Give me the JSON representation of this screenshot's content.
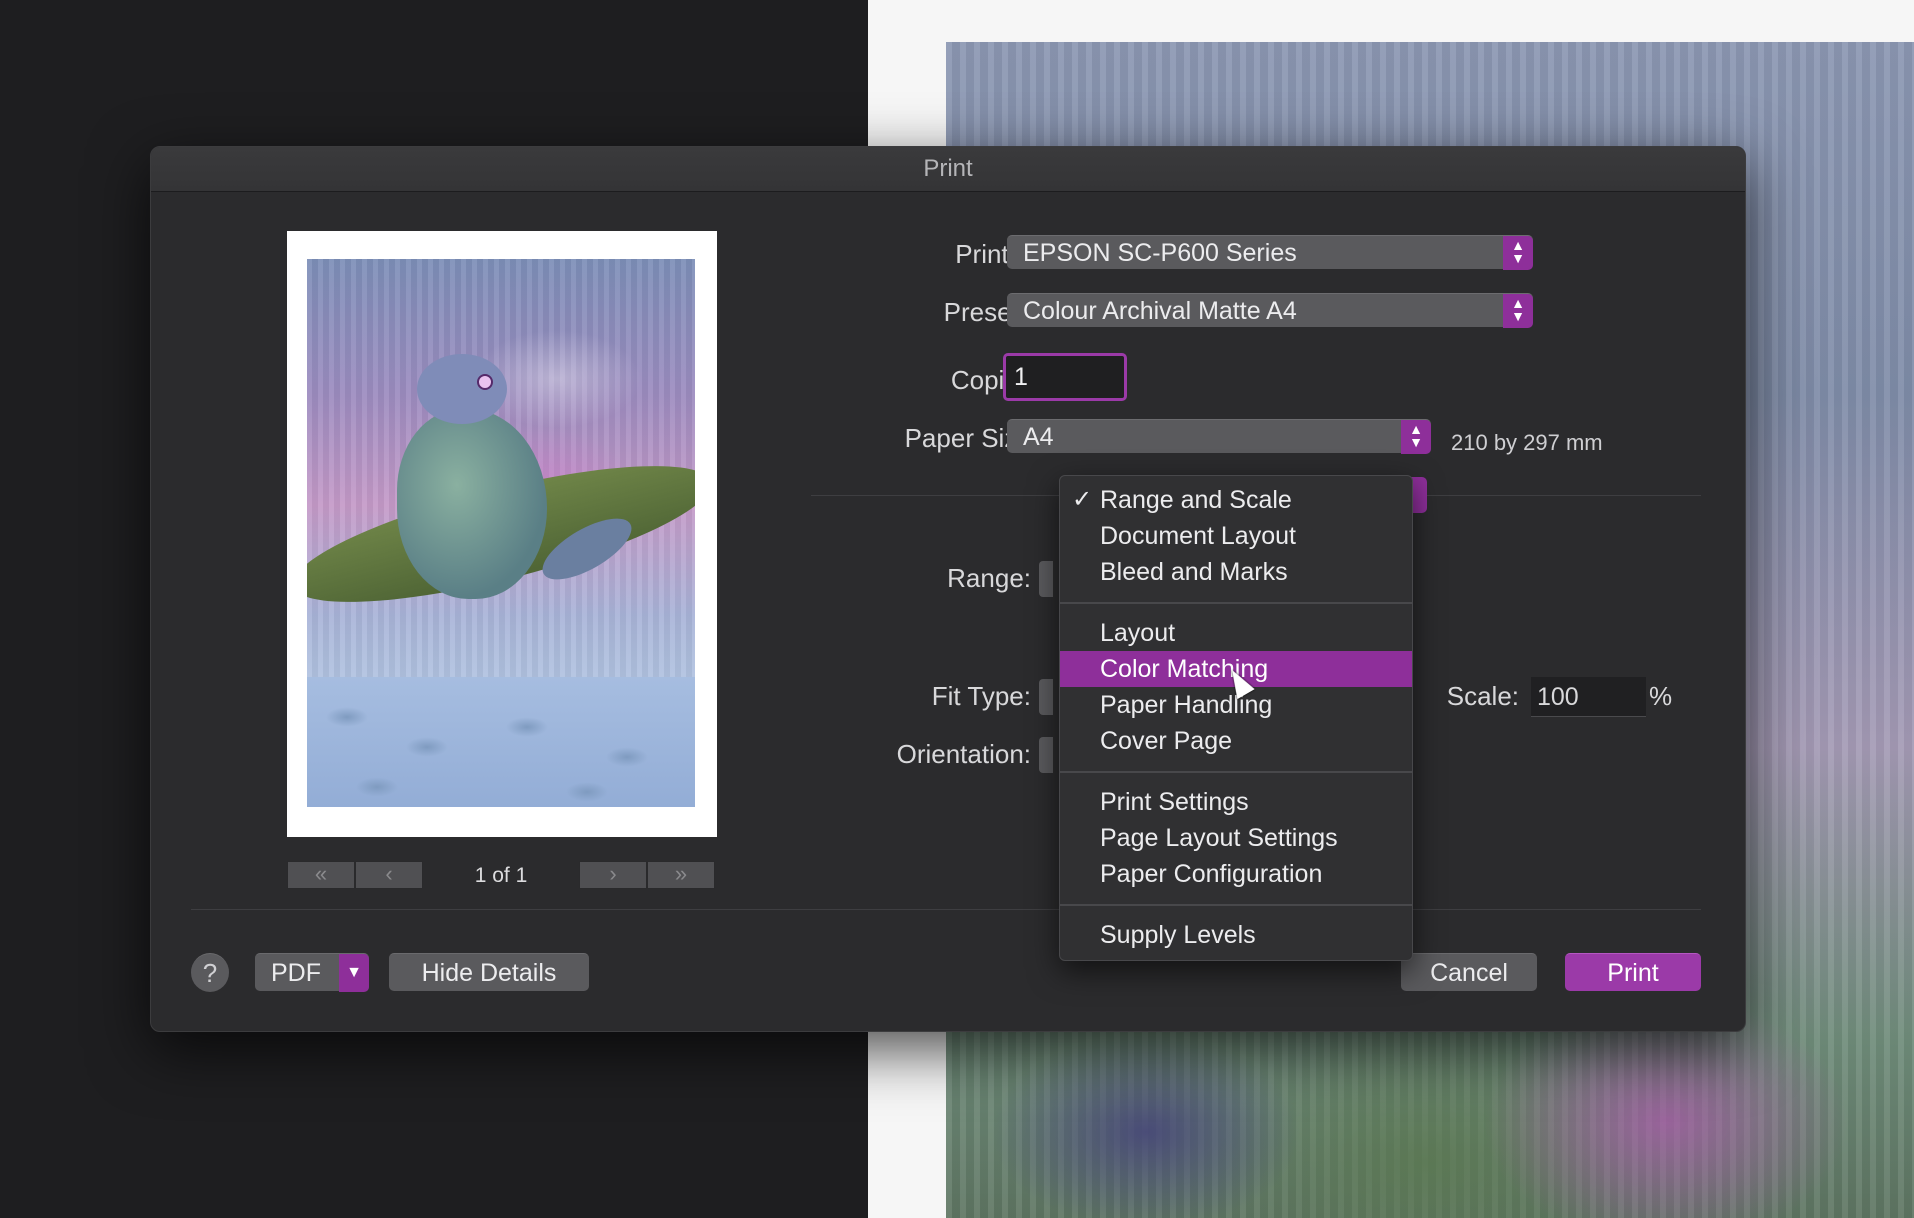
{
  "window": {
    "title": "Print"
  },
  "preview": {
    "page_indicator": "1 of 1",
    "first_label": "«",
    "prev_label": "‹",
    "next_label": "›",
    "last_label": "»"
  },
  "form": {
    "printer_label": "Printer:",
    "printer_value": "EPSON SC-P600 Series",
    "presets_label": "Presets:",
    "presets_value": "Colour Archival Matte A4",
    "copies_label": "Copies:",
    "copies_value": "1",
    "paper_size_label": "Paper Size:",
    "paper_size_value": "A4",
    "paper_size_dims": "210 by 297 mm",
    "range_label": "Range:",
    "fit_type_label": "Fit Type:",
    "orientation_label": "Orientation:",
    "scale_label": "Scale:",
    "scale_value": "100",
    "scale_unit": "%"
  },
  "menu": {
    "check_glyph": "✓",
    "items": [
      {
        "label": "Range and Scale",
        "checked": true
      },
      {
        "label": "Document Layout"
      },
      {
        "label": "Bleed and Marks"
      },
      {
        "label": "Layout"
      },
      {
        "label": "Color Matching",
        "highlighted": true
      },
      {
        "label": "Paper Handling"
      },
      {
        "label": "Cover Page"
      },
      {
        "label": "Print Settings"
      },
      {
        "label": "Page Layout Settings"
      },
      {
        "label": "Paper Configuration"
      },
      {
        "label": "Supply Levels"
      }
    ]
  },
  "footer": {
    "help_label": "?",
    "pdf_label": "PDF",
    "hide_details_label": "Hide Details",
    "cancel_label": "Cancel",
    "print_label": "Print"
  },
  "colors": {
    "accent": "#9b3aa8",
    "dialog_bg": "#2b2b2d",
    "control_bg": "#5a5a5d"
  }
}
